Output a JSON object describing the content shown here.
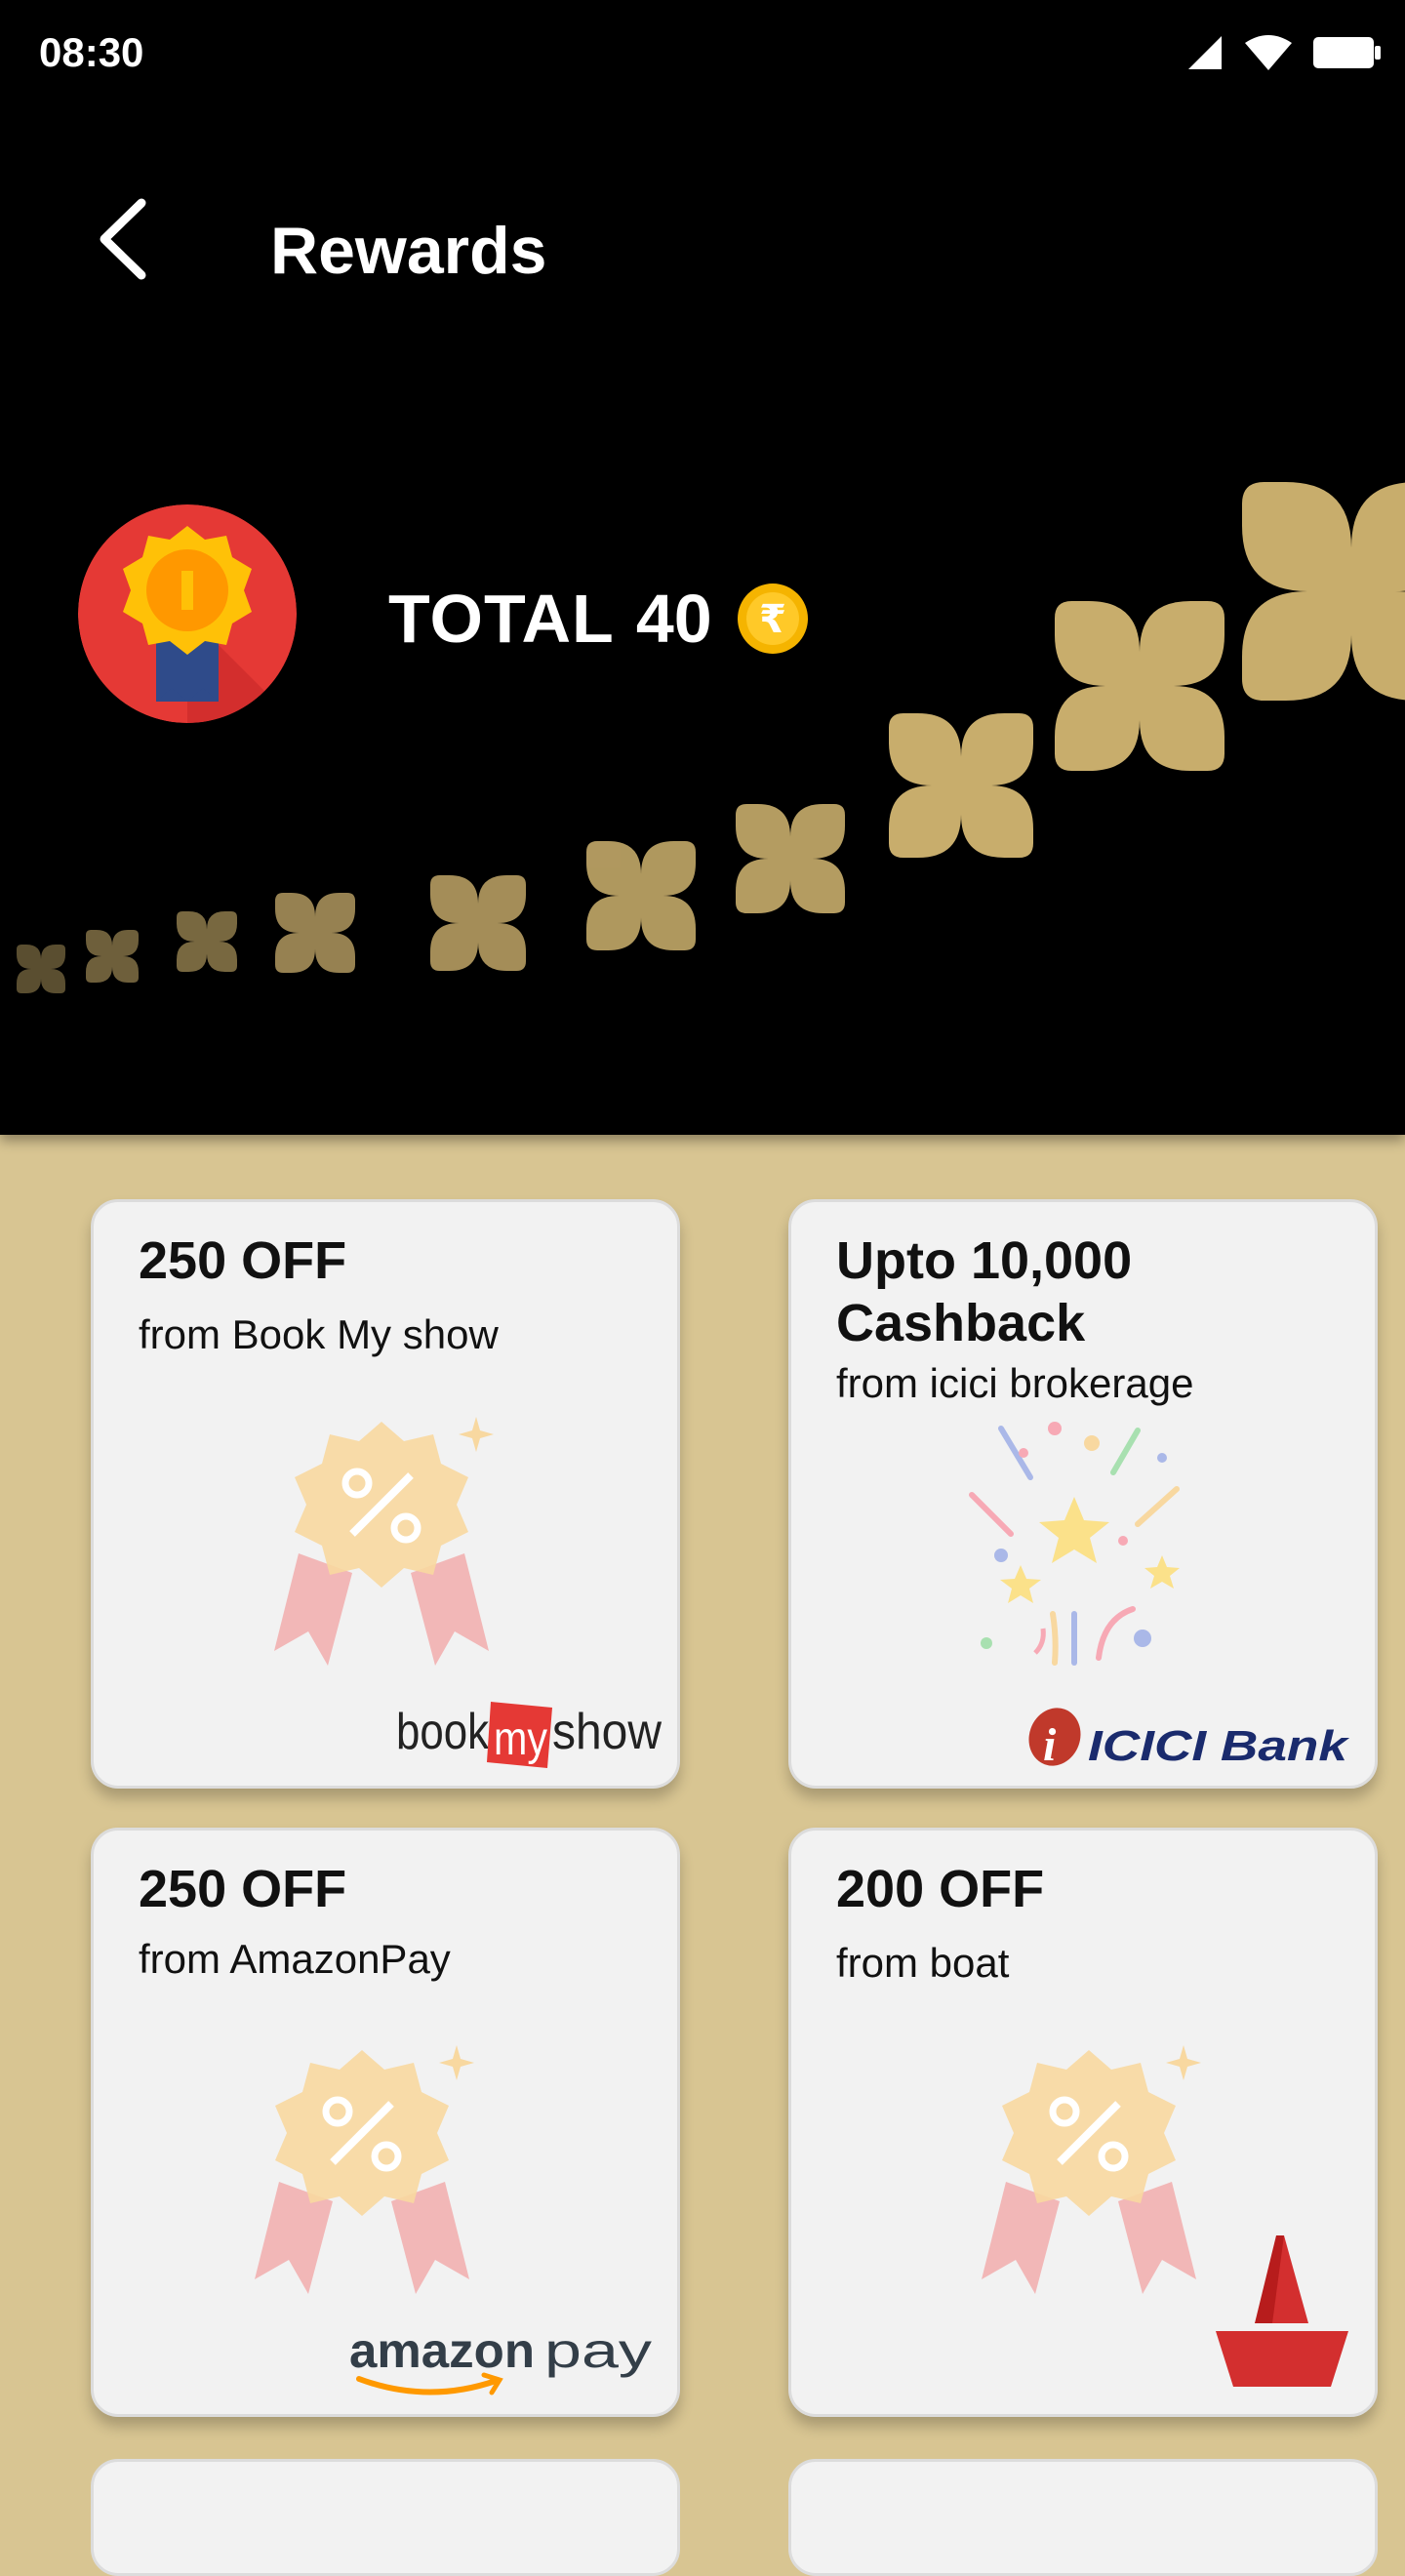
{
  "status_bar": {
    "time": "08:30",
    "icons": [
      "signal-icon",
      "wifi-icon",
      "battery-icon"
    ]
  },
  "app_bar": {
    "title": "Rewards",
    "back_icon": "back-arrow-icon"
  },
  "summary": {
    "total_label": "TOTAL",
    "total_value": "40",
    "coin_icon": "rupee-coin-icon",
    "medal_icon": "medal-icon"
  },
  "rewards": [
    {
      "title": "250 OFF",
      "subtitle": "from Book My show",
      "illustration": "discount-badge-icon",
      "brand": "bookmyshow"
    },
    {
      "title": "Upto 10,000 Cashback",
      "subtitle": "from icici brokerage",
      "illustration": "confetti-icon",
      "brand": "ICICI Bank"
    },
    {
      "title": "250 OFF",
      "subtitle": "from AmazonPay",
      "illustration": "discount-badge-icon",
      "brand": "amazon pay"
    },
    {
      "title": "200 OFF",
      "subtitle": "from boat",
      "illustration": "discount-badge-icon",
      "brand": "boat"
    }
  ],
  "colors": {
    "header_bg": "#000000",
    "page_bg": "#d8c592",
    "gold": "#c8ad6c",
    "card_bg": "#f2f2f2"
  }
}
